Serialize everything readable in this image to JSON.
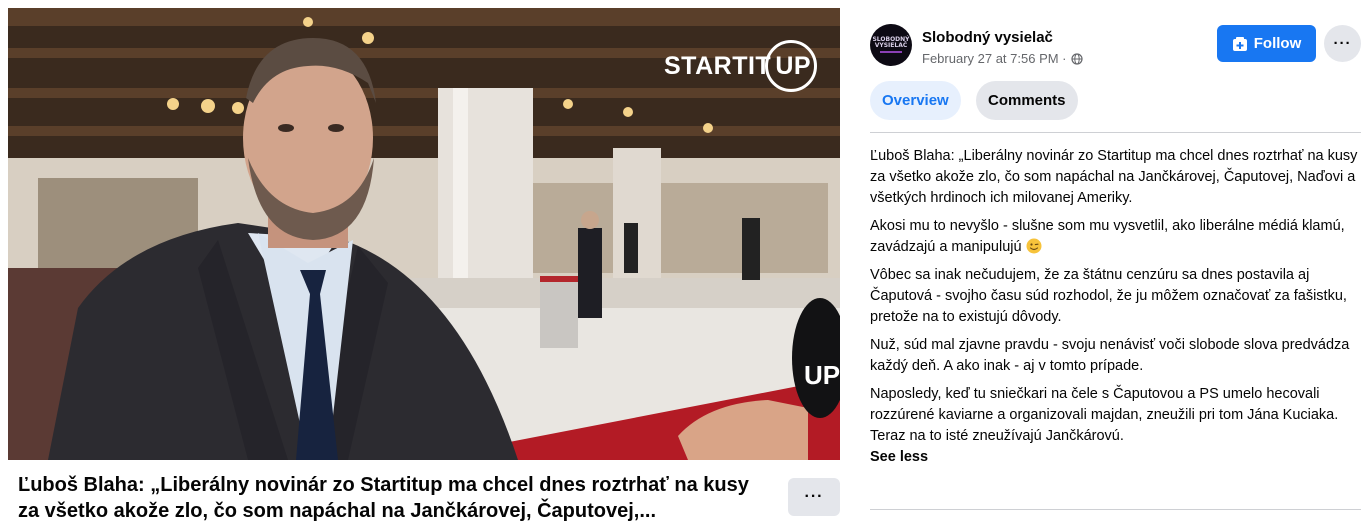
{
  "video": {
    "watermark_left": "STARTIT",
    "watermark_ring": "UP",
    "mic_label": "UP",
    "title": "Ľuboš Blaha: „Liberálny novinár zo Startitup ma chcel dnes roztrhať na kusy za všetko akože zlo, čo som napáchal na Jančkárovej, Čaputovej,...",
    "more_label": "···"
  },
  "post": {
    "page_name": "Slobodný vysielač",
    "timestamp": "February 27 at 7:56 PM ·",
    "avatar_text_1": "SLOBODNÝ",
    "avatar_text_2": "VYSIELAČ",
    "follow_label": "Follow",
    "more_label": "···",
    "tabs": [
      {
        "label": "Overview",
        "active": true
      },
      {
        "label": "Comments",
        "active": false
      }
    ],
    "paragraphs": [
      "Ľuboš Blaha: „Liberálny novinár zo Startitup ma chcel dnes roztrhať na kusy za všetko akože zlo, čo som napáchal na Jančkárovej, Čaputovej, Naďovi a všetkých hrdinoch ich milovanej Ameriky.",
      "Akosi mu to nevyšlo - slušne som mu vysvetlil, ako liberálne médiá klamú, zavádzajú a manipulujú",
      "Vôbec sa inak nečudujem, že za štátnu cenzúru sa dnes postavila aj Čaputová - svojho času súd rozhodol, že ju môžem označovať za fašistku, pretože na to existujú dôvody.",
      "Nuž, súd mal zjavne pravdu - svoju nenávisť voči slobode slova predvádza každý deň. A ako inak - aj v tomto prípade.",
      "Naposledy, keď tu sniečkari na čele s Čaputovou a PS umelo hecovali rozzúrené kaviarne a organizovali majdan, zneužili pri tom Jána Kuciaka. Teraz na to isté zneužívajú Jančkárovú."
    ],
    "see_less_label": "See less"
  },
  "colors": {
    "accent": "#1877f2",
    "tab_active_bg": "#e7f0fd",
    "button_gray": "#e4e6eb",
    "meta_text": "#65676b"
  }
}
